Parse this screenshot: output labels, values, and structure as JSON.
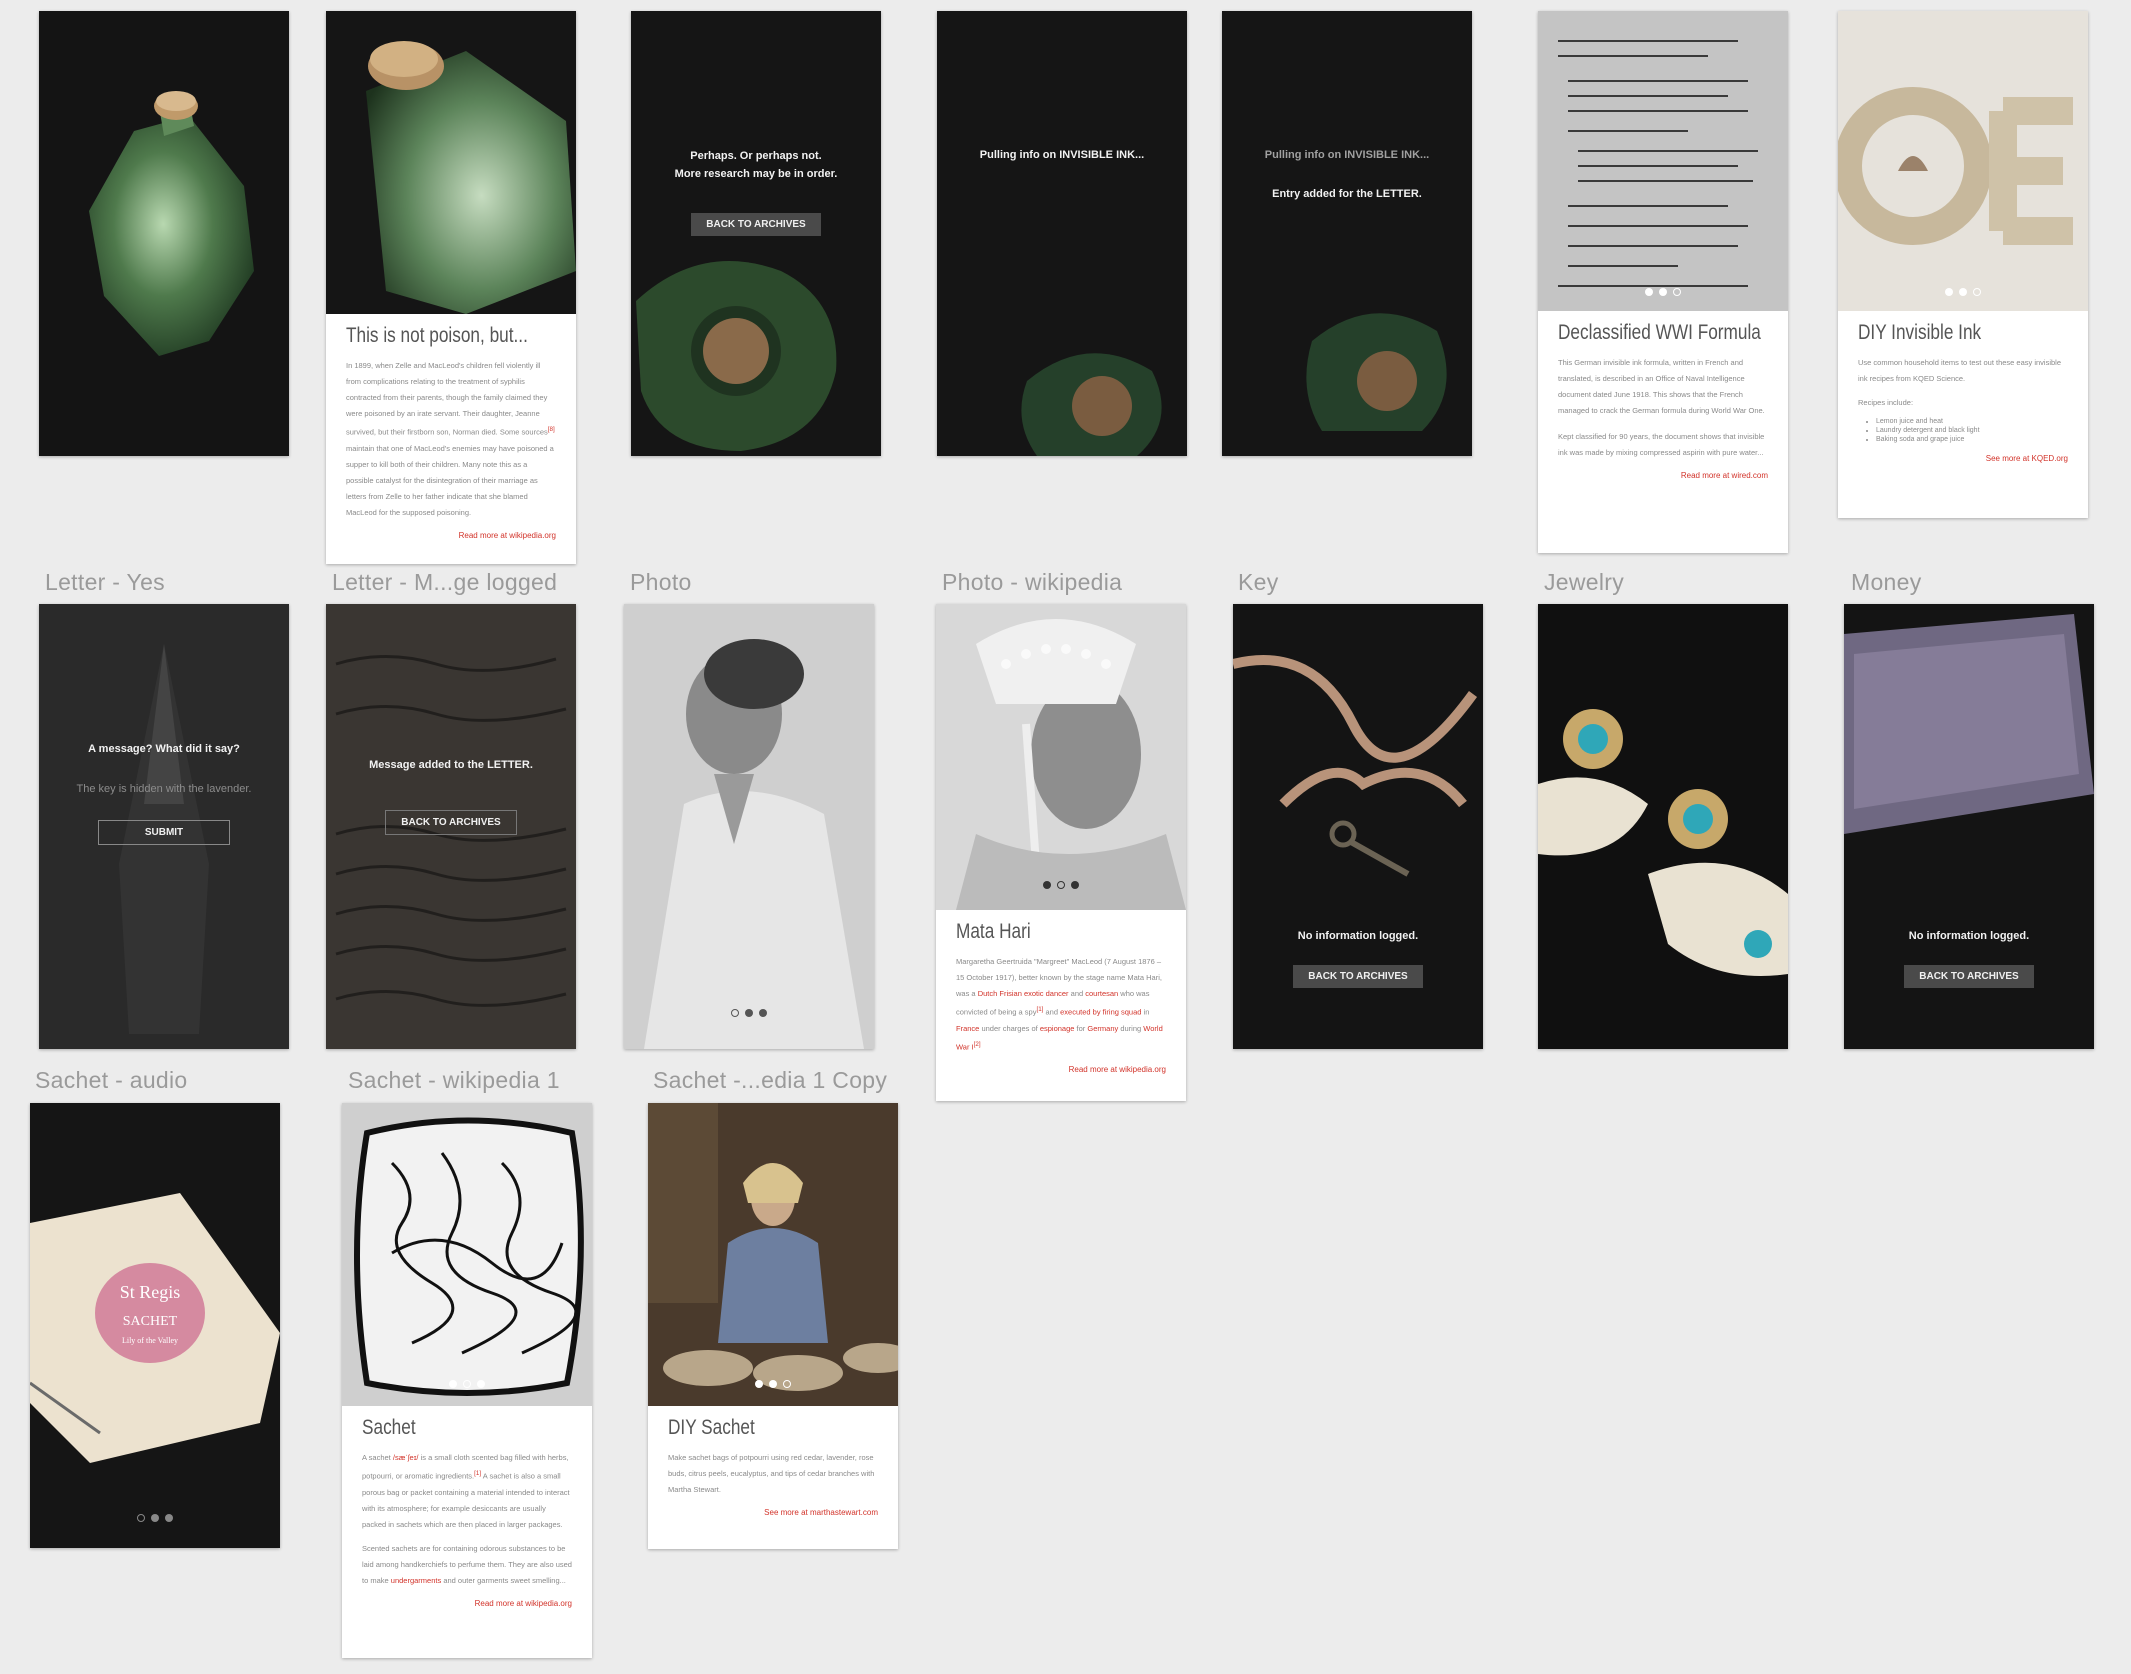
{
  "colors": {
    "background": "#ececec",
    "label": "#9a9a9a",
    "artboard_dark": "#161616",
    "link_red": "#d2332a"
  },
  "labels": {
    "letter_yes": "Letter - Yes",
    "letter_logged": "Letter - M...ge logged",
    "photo": "Photo",
    "photo_wiki": "Photo - wikipedia",
    "key": "Key",
    "jewelry": "Jewelry",
    "money": "Money",
    "sachet_audio": "Sachet - audio",
    "sachet_wiki": "Sachet - wikipedia 1",
    "sachet_copy": "Sachet -...edia 1 Copy"
  },
  "bottle_wiki": {
    "title": "This is not poison, but...",
    "body": "In 1899, when Zelle and MacLeod's children fell violently ill from complications relating to the treatment of syphilis contracted from their parents, though the family claimed they were poisoned by an irate servant. Their daughter, Jeanne survived, but their firstborn son, Norman died. Some sources",
    "ref": "[8]",
    "body2": "maintain that one of MacLeod's enemies may have poisoned a supper to kill both of their children. Many note this as a possible catalyst for the disintegration of their marriage as letters from Zelle to her father indicate that she blamed MacLeod for the supposed poisoning.",
    "read_more": "Read more at wikipedia.org"
  },
  "bottle_result": {
    "line1": "Perhaps. Or perhaps not.",
    "line2": "More research may be in order.",
    "button": "BACK TO ARCHIVES"
  },
  "bottle_pulling": {
    "line": "Pulling info on INVISIBLE INK..."
  },
  "bottle_added": {
    "line1": "Pulling info on INVISIBLE INK...",
    "line2": "Entry added for the LETTER."
  },
  "wwi": {
    "title": "Declassified WWI Formula",
    "body": "This German invisible ink formula, written in French and translated, is described in an Office of Naval Intelligence document dated June 1918. This shows that the French managed to crack the German formula during World War One.",
    "body2": "Kept classified for 90 years, the document shows that invisible ink was made by mixing compressed aspirin with pure water...",
    "read_more": "Read more at wired.com"
  },
  "diy_ink": {
    "title": "DIY Invisible Ink",
    "body": "Use common household items to test out these easy invisible ink recipes from KQED Science.",
    "recipes_label": "Recipes include:",
    "recipes": [
      "Lemon juice and heat",
      "Laundry detergent and black light",
      "Baking soda and grape juice"
    ],
    "read_more": "See more at KQED.org"
  },
  "letter_yes": {
    "line1": "A message? What did it say?",
    "placeholder": "The key is hidden with the lavender.",
    "button": "SUBMIT"
  },
  "letter_logged": {
    "line1": "Message added to the LETTER.",
    "button": "BACK TO ARCHIVES"
  },
  "mata_hari": {
    "title": "Mata Hari",
    "body": "Margaretha Geertruida \"Margreet\" MacLeod (7 August 1876 – 15 October 1917), better known by the stage name Mata Hari, was a",
    "link1": "Dutch Frisian exotic dancer",
    "body2": "and",
    "link2": "courtesan",
    "body3": "who was convicted of being a spy",
    "ref1": "[1]",
    "body4": "and",
    "link3": "executed by firing squad",
    "body5": "in",
    "link4": "France",
    "body6": "under charges of",
    "link5": "espionage",
    "body7": "for",
    "link6": "Germany",
    "body8": "during",
    "link7": "World War I",
    "ref2": "[2]",
    "read_more": "Read more at wikipedia.org"
  },
  "key_screen": {
    "line1": "No information logged.",
    "button": "BACK TO ARCHIVES"
  },
  "money_screen": {
    "line1": "No information logged.",
    "button": "BACK TO ARCHIVES"
  },
  "sachet": {
    "title": "Sachet",
    "body": "A sachet",
    "pron": "/sæˈʃeɪ/",
    "body_b": "is a small cloth scented bag filled with herbs, potpourri, or aromatic ingredients.",
    "ref": "[1]",
    "body_c": "A sachet is also a small porous bag or packet containing a material intended to interact with its atmosphere; for example desiccants are usually packed in sachets which are then placed in larger packages.",
    "body2": "Scented sachets are for containing odorous substances to be laid among handkerchiefs to perfume them. They are also used to make",
    "link": "undergarments",
    "body3": "and outer garments sweet smelling...",
    "read_more": "Read more at wikipedia.org"
  },
  "diy_sachet": {
    "title": "DIY Sachet",
    "body": "Make sachet bags of potpourri using red cedar, lavender, rose buds, citrus peels, eucalyptus, and tips of cedar branches with Martha Stewart.",
    "read_more": "See more at marthastewart.com"
  },
  "sachet_art": {
    "brand": "St Regis",
    "line": "SACHET",
    "sub": "Lily of the Valley"
  }
}
